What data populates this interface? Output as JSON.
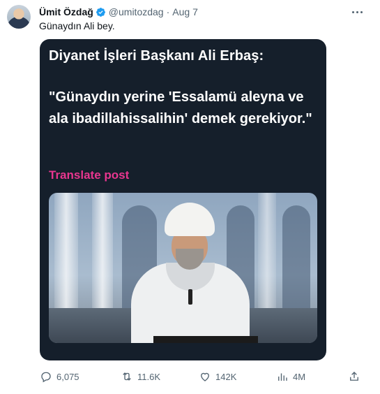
{
  "tweet": {
    "author_name": "Ümit Özdağ",
    "handle": "@umitozdag",
    "separator": "·",
    "date": "Aug 7",
    "text": "Günaydın Ali bey."
  },
  "card": {
    "title": "Diyanet İşleri Başkanı Ali Erbaş:",
    "quote": "\"Günaydın yerine 'Essalamü aleyna ve ala ibadillahissalihin' demek gerekiyor.\"",
    "translate_label": "Translate post"
  },
  "actions": {
    "replies": "6,075",
    "reposts": "11.6K",
    "likes": "142K",
    "views": "4M"
  },
  "colors": {
    "card_background": "#151f2b",
    "translate_link": "#e8368f",
    "verified_badge": "#1d9bf0",
    "muted_text": "#536471"
  },
  "icons": {
    "verified": "verified-badge-icon",
    "more": "more-icon",
    "reply": "reply-icon",
    "repost": "repost-icon",
    "like": "like-icon",
    "views": "views-icon",
    "share": "share-icon"
  }
}
